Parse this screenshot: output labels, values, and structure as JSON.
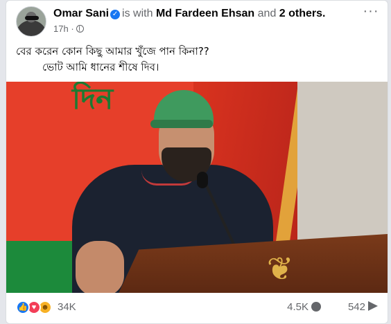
{
  "post": {
    "author": "Omar Sani",
    "verified_icon": "verified-badge-icon",
    "with_text": "is with",
    "tagged": "Md Fardeen Ehsan",
    "and_text": "and",
    "others": "2 others.",
    "time": "17h",
    "audience_icon": "globe-icon",
    "menu": "···",
    "text_line1": "বের করেন কোন কিছু আমার  খুঁজে পান কিনা??",
    "text_line2": "ভোট আমি ধানের শীষে দিব।"
  },
  "media": {
    "banner_text": "দিন"
  },
  "footer": {
    "reactions": [
      "like-icon",
      "love-icon",
      "haha-icon"
    ],
    "reaction_count": "34K",
    "comment_count": "4.5K",
    "share_count": "542"
  },
  "colors": {
    "accent": "#1877f2",
    "secondary_text": "#65676b"
  }
}
